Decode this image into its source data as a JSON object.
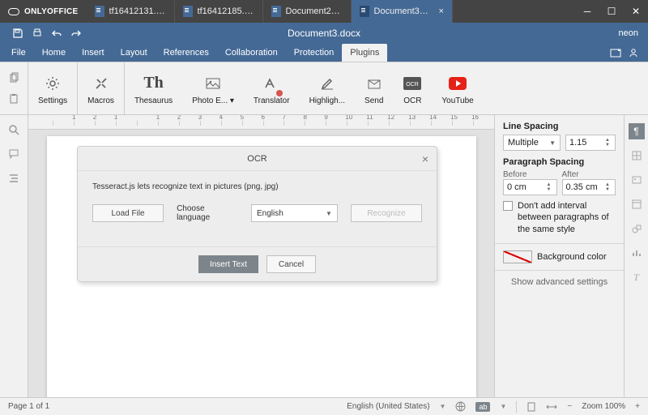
{
  "app": {
    "name": "ONLYOFFICE"
  },
  "tabs": [
    {
      "label": "tf16412131.do..."
    },
    {
      "label": "tf16412185.do..."
    },
    {
      "label": "Document2.d..."
    },
    {
      "label": "Document3.d...",
      "active": true
    }
  ],
  "header": {
    "title": "Document3.docx",
    "user": "neon"
  },
  "menu": {
    "file": "File",
    "home": "Home",
    "insert": "Insert",
    "layout": "Layout",
    "references": "References",
    "collaboration": "Collaboration",
    "protection": "Protection",
    "plugins": "Plugins"
  },
  "toolbar": {
    "settings": "Settings",
    "macros": "Macros",
    "thesaurus": "Thesaurus",
    "photoed": "Photo E...",
    "translator": "Translator",
    "highlight": "Highligh...",
    "send": "Send",
    "ocr": "OCR",
    "youtube": "YouTube"
  },
  "dialog": {
    "title": "OCR",
    "desc": "Tesseract.js lets recognize text in pictures (png, jpg)",
    "load": "Load File",
    "choose": "Choose language",
    "language": "English",
    "recognize": "Recognize",
    "insert": "Insert Text",
    "cancel": "Cancel"
  },
  "panel": {
    "lineSpacing": "Line Spacing",
    "lineMode": "Multiple",
    "lineVal": "1.15",
    "paraSpacing": "Paragraph Spacing",
    "before": "Before",
    "beforeVal": "0 cm",
    "after": "After",
    "afterVal": "0.35 cm",
    "noInterval": "Don't add interval between paragraphs of the same style",
    "bg": "Background color",
    "advanced": "Show advanced settings"
  },
  "status": {
    "page": "Page 1 of 1",
    "lang": "English (United States)",
    "zoom": "Zoom 100%"
  },
  "ruler_ticks": [
    "",
    "1",
    "2",
    "1",
    "",
    "1",
    "2",
    "3",
    "4",
    "5",
    "6",
    "7",
    "8",
    "9",
    "10",
    "11",
    "12",
    "13",
    "14",
    "15",
    "16"
  ]
}
